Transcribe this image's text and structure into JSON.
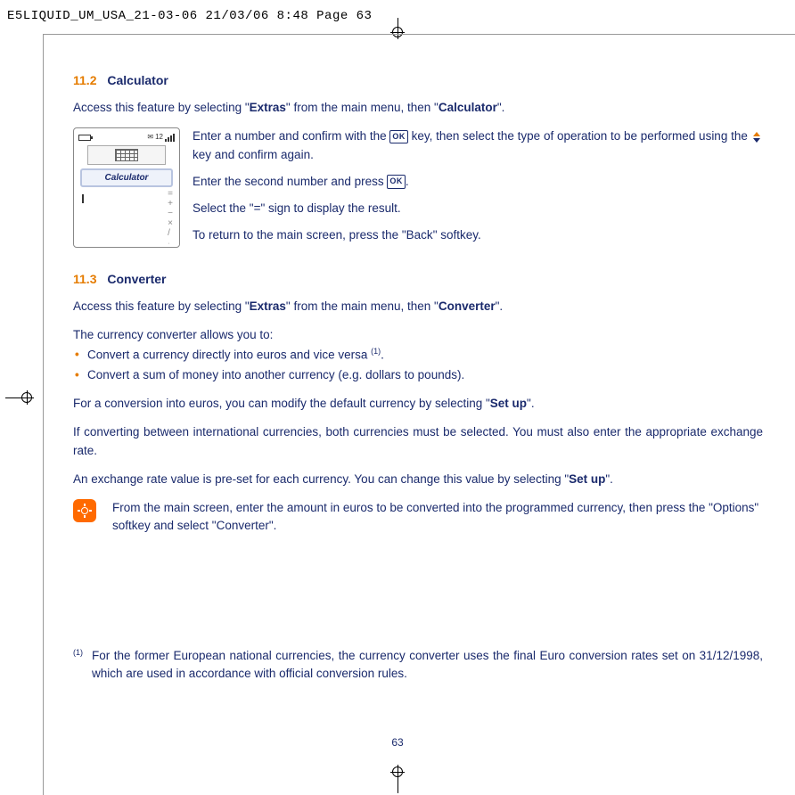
{
  "header": "E5LIQUID_UM_USA_21-03-06  21/03/06  8:48  Page 63",
  "sec_calc": {
    "num": "11.2",
    "title": "Calculator"
  },
  "calc_intro_a": "Access this feature by selecting \"",
  "calc_intro_b": "\" from the main menu, then \"",
  "calc_intro_c": "\".",
  "extras": "Extras",
  "calculator_word": "Calculator",
  "phone_label": "Calculator",
  "calc_p1_a": "Enter a number and confirm with the ",
  "calc_p1_b": " key, then select the type of operation to be performed using the ",
  "calc_p1_c": " key and confirm again.",
  "calc_p2_a": "Enter the second number and press ",
  "calc_p2_b": ".",
  "calc_p3_a": "Select the \"",
  "calc_p3_eq": "=",
  "calc_p3_b": "\" sign to display the result.",
  "calc_p4_a": "To return to the main screen, press the \"",
  "calc_p4_back": "Back",
  "calc_p4_b": "\" softkey.",
  "sec_conv": {
    "num": "11.3",
    "title": "Converter"
  },
  "conv_intro_a": "Access this feature by selecting \"",
  "conv_intro_b": "\" from the main menu, then \"",
  "conv_intro_c": "\".",
  "converter_word": "Converter",
  "conv_p1": "The currency converter allows you to:",
  "conv_li1_a": "Convert a currency directly into euros and vice versa ",
  "conv_li1_sup": "(1)",
  "conv_li1_b": ".",
  "conv_li2": "Convert a sum of money into another currency (e.g. dollars to pounds).",
  "conv_p2_a": "For a conversion into euros, you can modify the default currency by selecting \"",
  "setup": "Set up",
  "conv_p2_b": "\".",
  "conv_p3": "If converting between international currencies, both currencies must be selected. You must also enter the appropriate exchange rate.",
  "conv_p4_a": "An exchange rate value is pre-set for each currency. You can change this value by selecting \"",
  "conv_p4_b": "\".",
  "tip_a": "From the main screen, enter the amount in euros to be converted into the programmed currency, then press the \"",
  "options": "Options",
  "tip_b": "\" softkey and select \"",
  "tip_c": "\".",
  "fn_mark": "(1)",
  "fn_text": "For the former European national currencies, the currency converter uses the final Euro conversion rates set on 31/12/1998, which are used in accordance with official conversion rules.",
  "pagenum": "63",
  "ok_label": "OK"
}
